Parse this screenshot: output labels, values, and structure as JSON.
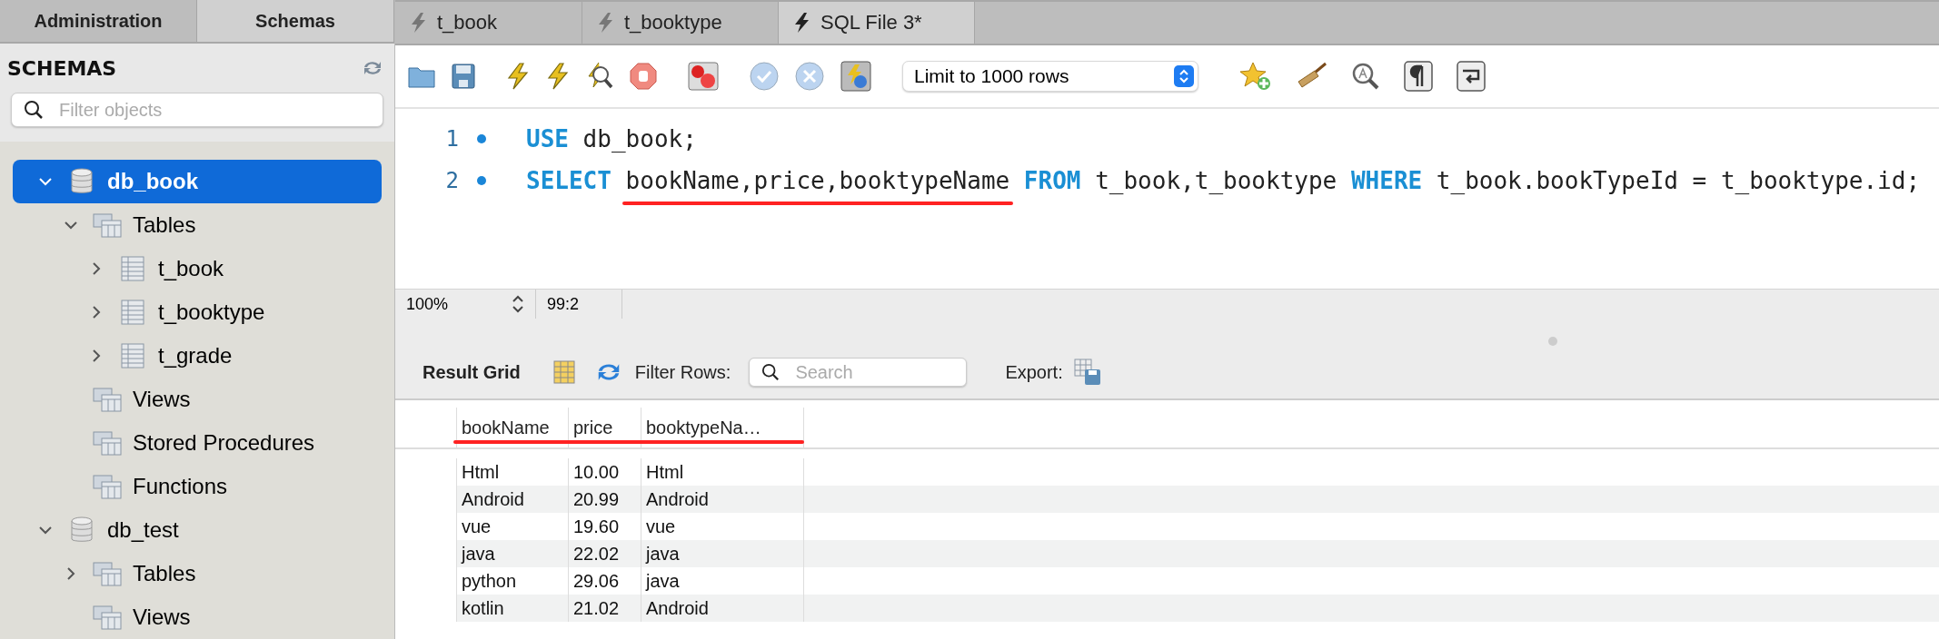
{
  "sidebar": {
    "tabs": [
      {
        "label": "Administration",
        "selected": false
      },
      {
        "label": "Schemas",
        "selected": true
      }
    ],
    "title": "SCHEMAS",
    "filter": {
      "placeholder": "Filter objects"
    },
    "tree": [
      {
        "label": "db_book",
        "kind": "schema",
        "expanded": true,
        "selected": true,
        "children": [
          {
            "label": "Tables",
            "kind": "folder",
            "expanded": true,
            "selected": false,
            "children": [
              {
                "label": "t_book",
                "kind": "table",
                "expanded": false,
                "selected": false
              },
              {
                "label": "t_booktype",
                "kind": "table",
                "expanded": false,
                "selected": false
              },
              {
                "label": "t_grade",
                "kind": "table",
                "expanded": false,
                "selected": false
              }
            ]
          },
          {
            "label": "Views",
            "kind": "folder",
            "selected": false
          },
          {
            "label": "Stored Procedures",
            "kind": "folder",
            "selected": false
          },
          {
            "label": "Functions",
            "kind": "folder",
            "selected": false
          }
        ]
      },
      {
        "label": "db_test",
        "kind": "schema",
        "expanded": true,
        "selected": false,
        "children": [
          {
            "label": "Tables",
            "kind": "folder",
            "expanded": false,
            "selected": false
          },
          {
            "label": "Views",
            "kind": "folder",
            "selected": false
          }
        ]
      }
    ]
  },
  "editor_tabs": [
    {
      "label": "t_book",
      "selected": false
    },
    {
      "label": "t_booktype",
      "selected": false
    },
    {
      "label": "SQL File 3*",
      "selected": true
    }
  ],
  "toolbar": {
    "limit": "Limit to 1000 rows"
  },
  "editor": {
    "lines": [
      {
        "number": "1",
        "tokens": [
          {
            "kind": "keyword",
            "text": "USE"
          },
          {
            "kind": "plain",
            "text": " db_book;"
          }
        ]
      },
      {
        "number": "2",
        "tokens": [
          {
            "kind": "keyword",
            "text": "SELECT "
          },
          {
            "kind": "plain",
            "text": "bookName,price,booktypeName",
            "underlined": true
          },
          {
            "kind": "keyword",
            "text": " FROM"
          },
          {
            "kind": "plain",
            "text": " t_book,t_booktype "
          },
          {
            "kind": "keyword",
            "text": "WHERE"
          },
          {
            "kind": "plain",
            "text": " t_book.bookTypeId = t_booktype.id;"
          }
        ]
      }
    ]
  },
  "status": {
    "zoom": "100%",
    "position": "99:2"
  },
  "results": {
    "title": "Result Grid",
    "filter_label": "Filter Rows:",
    "search_placeholder": "Search",
    "export_label": "Export:",
    "columns": [
      "bookName",
      "price",
      "booktypeNa…"
    ],
    "header_underlined": true,
    "rows": [
      [
        "Html",
        "10.00",
        "Html"
      ],
      [
        "Android",
        "20.99",
        "Android"
      ],
      [
        "vue",
        "19.60",
        "vue"
      ],
      [
        "java",
        "22.02",
        "java"
      ],
      [
        "python",
        "29.06",
        "java"
      ],
      [
        "kotlin",
        "21.02",
        "Android"
      ]
    ]
  }
}
